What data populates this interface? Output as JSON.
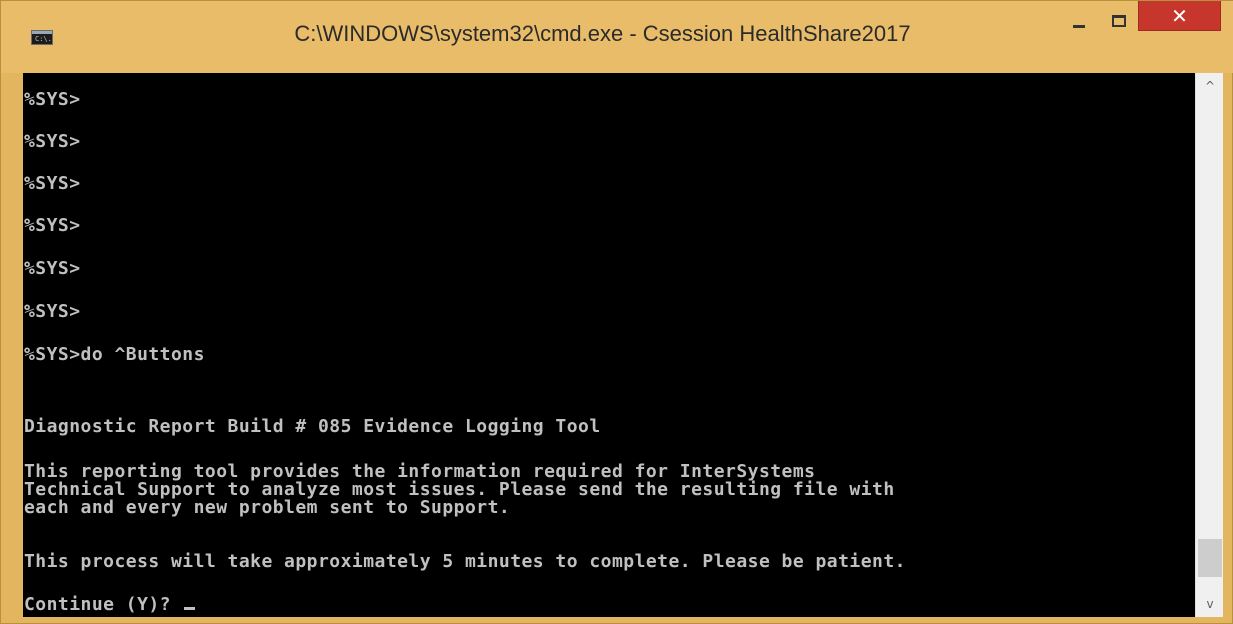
{
  "window": {
    "title": "C:\\WINDOWS\\system32\\cmd.exe - Csession  HealthShare2017",
    "icon_label": "C:\\.",
    "close_label": "✕",
    "colors": {
      "frame": "#e8bc68",
      "close": "#c7362c",
      "console_bg": "#000000",
      "console_fg": "#c0c0c0"
    }
  },
  "console": {
    "lines": [
      "%SYS>",
      "%SYS>",
      "%SYS>",
      "%SYS>",
      "%SYS>",
      "%SYS>",
      "%SYS>do ^Buttons",
      "Diagnostic Report Build # 085 Evidence Logging Tool",
      "This reporting tool provides the information required for InterSystems",
      "Technical Support to analyze most issues. Please send the resulting file with",
      "each and every new problem sent to Support.",
      "This process will take approximately 5 minutes to complete. Please be patient.",
      "Continue (Y)? "
    ]
  },
  "scrollbar": {
    "up_icon": "chevron-up-icon",
    "down_icon": "chevron-down-icon",
    "up_glyph": "^",
    "down_glyph": "v",
    "position": 0.97
  }
}
